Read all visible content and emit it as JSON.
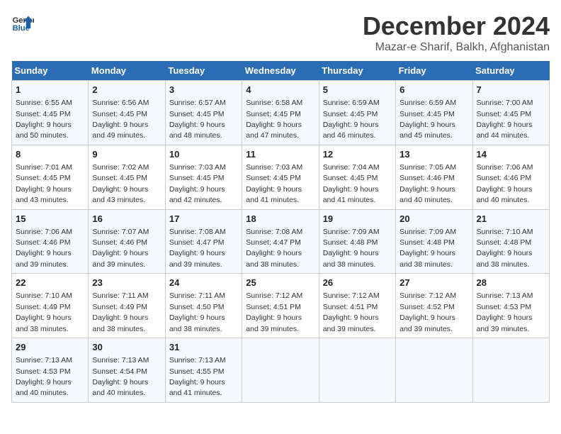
{
  "header": {
    "logo_line1": "General",
    "logo_line2": "Blue",
    "title": "December 2024",
    "subtitle": "Mazar-e Sharif, Balkh, Afghanistan"
  },
  "calendar": {
    "days_of_week": [
      "Sunday",
      "Monday",
      "Tuesday",
      "Wednesday",
      "Thursday",
      "Friday",
      "Saturday"
    ],
    "weeks": [
      [
        null,
        {
          "day": 2,
          "sunrise": "6:56 AM",
          "sunset": "4:45 PM",
          "daylight": "9 hours and 49 minutes."
        },
        {
          "day": 3,
          "sunrise": "6:57 AM",
          "sunset": "4:45 PM",
          "daylight": "9 hours and 48 minutes."
        },
        {
          "day": 4,
          "sunrise": "6:58 AM",
          "sunset": "4:45 PM",
          "daylight": "9 hours and 47 minutes."
        },
        {
          "day": 5,
          "sunrise": "6:59 AM",
          "sunset": "4:45 PM",
          "daylight": "9 hours and 46 minutes."
        },
        {
          "day": 6,
          "sunrise": "6:59 AM",
          "sunset": "4:45 PM",
          "daylight": "9 hours and 45 minutes."
        },
        {
          "day": 7,
          "sunrise": "7:00 AM",
          "sunset": "4:45 PM",
          "daylight": "9 hours and 44 minutes."
        }
      ],
      [
        {
          "day": 1,
          "sunrise": "6:55 AM",
          "sunset": "4:45 PM",
          "daylight": "9 hours and 50 minutes."
        },
        null,
        null,
        null,
        null,
        null,
        null
      ],
      [
        {
          "day": 8,
          "sunrise": "7:01 AM",
          "sunset": "4:45 PM",
          "daylight": "9 hours and 43 minutes."
        },
        {
          "day": 9,
          "sunrise": "7:02 AM",
          "sunset": "4:45 PM",
          "daylight": "9 hours and 43 minutes."
        },
        {
          "day": 10,
          "sunrise": "7:03 AM",
          "sunset": "4:45 PM",
          "daylight": "9 hours and 42 minutes."
        },
        {
          "day": 11,
          "sunrise": "7:03 AM",
          "sunset": "4:45 PM",
          "daylight": "9 hours and 41 minutes."
        },
        {
          "day": 12,
          "sunrise": "7:04 AM",
          "sunset": "4:45 PM",
          "daylight": "9 hours and 41 minutes."
        },
        {
          "day": 13,
          "sunrise": "7:05 AM",
          "sunset": "4:46 PM",
          "daylight": "9 hours and 40 minutes."
        },
        {
          "day": 14,
          "sunrise": "7:06 AM",
          "sunset": "4:46 PM",
          "daylight": "9 hours and 40 minutes."
        }
      ],
      [
        {
          "day": 15,
          "sunrise": "7:06 AM",
          "sunset": "4:46 PM",
          "daylight": "9 hours and 39 minutes."
        },
        {
          "day": 16,
          "sunrise": "7:07 AM",
          "sunset": "4:46 PM",
          "daylight": "9 hours and 39 minutes."
        },
        {
          "day": 17,
          "sunrise": "7:08 AM",
          "sunset": "4:47 PM",
          "daylight": "9 hours and 39 minutes."
        },
        {
          "day": 18,
          "sunrise": "7:08 AM",
          "sunset": "4:47 PM",
          "daylight": "9 hours and 38 minutes."
        },
        {
          "day": 19,
          "sunrise": "7:09 AM",
          "sunset": "4:48 PM",
          "daylight": "9 hours and 38 minutes."
        },
        {
          "day": 20,
          "sunrise": "7:09 AM",
          "sunset": "4:48 PM",
          "daylight": "9 hours and 38 minutes."
        },
        {
          "day": 21,
          "sunrise": "7:10 AM",
          "sunset": "4:48 PM",
          "daylight": "9 hours and 38 minutes."
        }
      ],
      [
        {
          "day": 22,
          "sunrise": "7:10 AM",
          "sunset": "4:49 PM",
          "daylight": "9 hours and 38 minutes."
        },
        {
          "day": 23,
          "sunrise": "7:11 AM",
          "sunset": "4:49 PM",
          "daylight": "9 hours and 38 minutes."
        },
        {
          "day": 24,
          "sunrise": "7:11 AM",
          "sunset": "4:50 PM",
          "daylight": "9 hours and 38 minutes."
        },
        {
          "day": 25,
          "sunrise": "7:12 AM",
          "sunset": "4:51 PM",
          "daylight": "9 hours and 39 minutes."
        },
        {
          "day": 26,
          "sunrise": "7:12 AM",
          "sunset": "4:51 PM",
          "daylight": "9 hours and 39 minutes."
        },
        {
          "day": 27,
          "sunrise": "7:12 AM",
          "sunset": "4:52 PM",
          "daylight": "9 hours and 39 minutes."
        },
        {
          "day": 28,
          "sunrise": "7:13 AM",
          "sunset": "4:53 PM",
          "daylight": "9 hours and 39 minutes."
        }
      ],
      [
        {
          "day": 29,
          "sunrise": "7:13 AM",
          "sunset": "4:53 PM",
          "daylight": "9 hours and 40 minutes."
        },
        {
          "day": 30,
          "sunrise": "7:13 AM",
          "sunset": "4:54 PM",
          "daylight": "9 hours and 40 minutes."
        },
        {
          "day": 31,
          "sunrise": "7:13 AM",
          "sunset": "4:55 PM",
          "daylight": "9 hours and 41 minutes."
        },
        null,
        null,
        null,
        null
      ]
    ]
  }
}
